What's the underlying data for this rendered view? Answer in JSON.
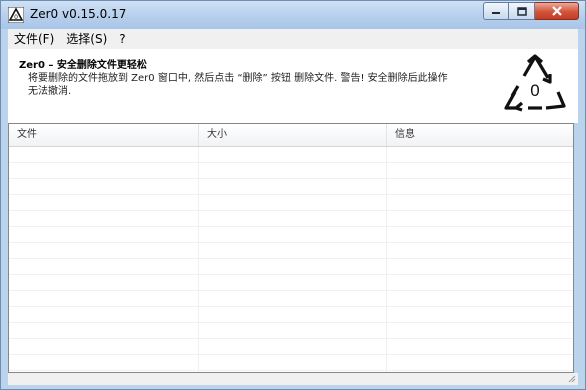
{
  "window": {
    "title": "Zer0 v0.15.0.17",
    "app_icon": "recycle-triangle-icon"
  },
  "menu": {
    "items": [
      {
        "label": "文件(F)"
      },
      {
        "label": "选择(S)"
      },
      {
        "label": "?"
      }
    ]
  },
  "header": {
    "title": "Zer0 – 安全删除文件更轻松",
    "description": "将要删除的文件拖放到 Zer0 窗口中, 然后点击 “删除” 按钮 删除文件. 警告! 安全删除后此操作无法撤消.",
    "logo_digit": "0",
    "logo_icon": "recycle-zero-icon"
  },
  "table": {
    "columns": [
      {
        "label": "文件"
      },
      {
        "label": "大小"
      },
      {
        "label": "信息"
      }
    ],
    "rows": []
  },
  "colors": {
    "titlebar": "#b6cfec",
    "close_button": "#d2533a",
    "menu_background": "#f0f0f0"
  }
}
